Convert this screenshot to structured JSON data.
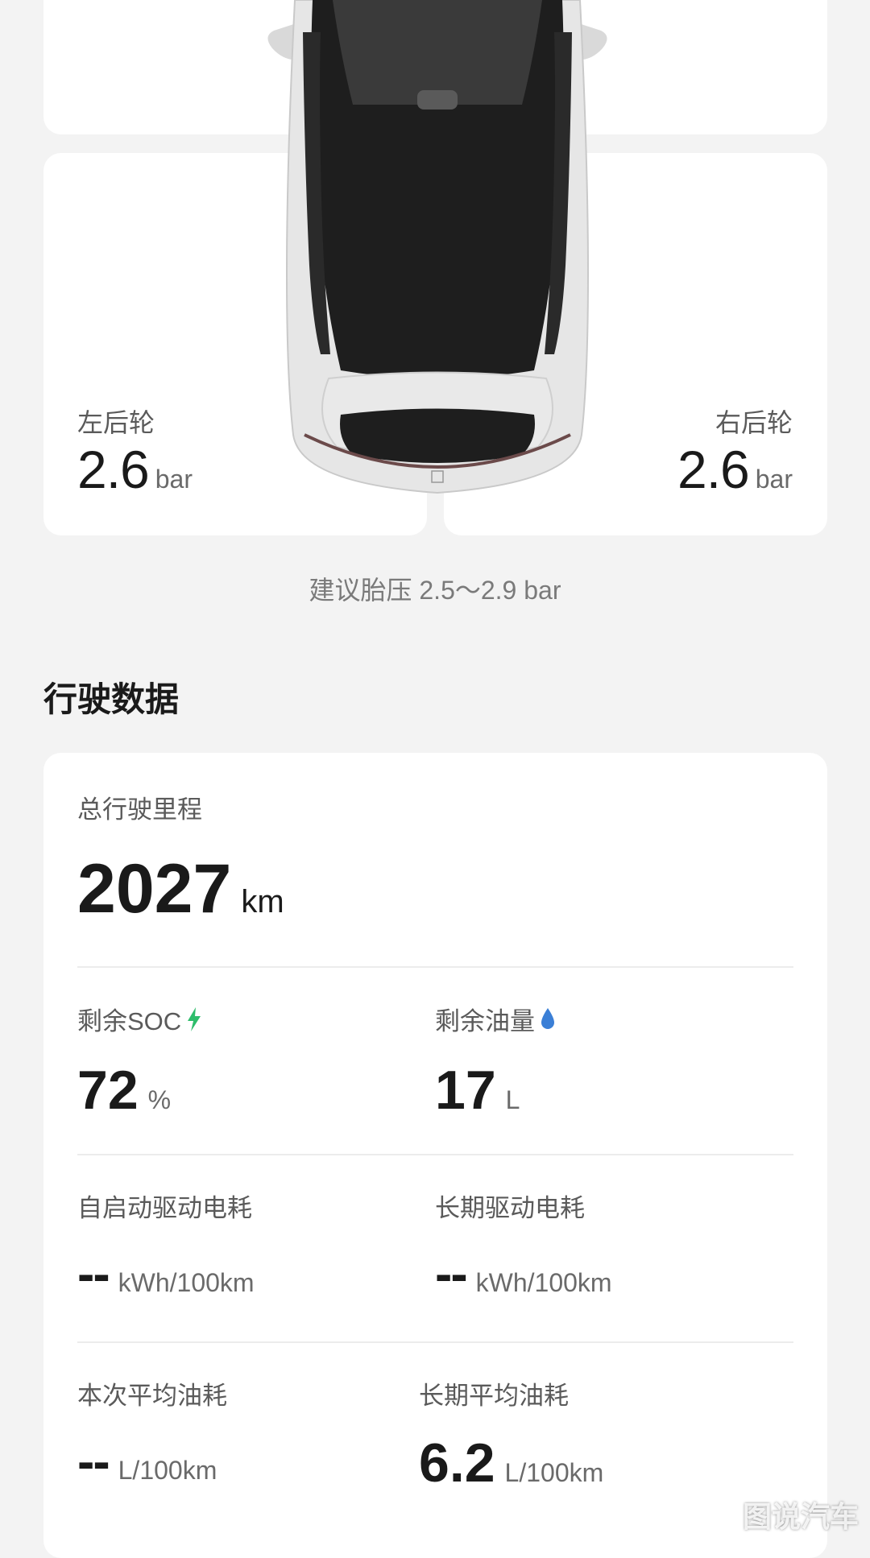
{
  "tires": {
    "rear_left": {
      "label": "左后轮",
      "value": "2.6",
      "unit": "bar"
    },
    "rear_right": {
      "label": "右后轮",
      "value": "2.6",
      "unit": "bar"
    },
    "recommendation": "建议胎压 2.5～2.9 bar"
  },
  "driving": {
    "section_title": "行驶数据",
    "total_mileage": {
      "label": "总行驶里程",
      "value": "2027",
      "unit": "km"
    },
    "soc": {
      "label": "剩余SOC",
      "value": "72",
      "unit": "%",
      "icon": "lightning-icon",
      "icon_color": "#2ebd6b"
    },
    "fuel": {
      "label": "剩余油量",
      "value": "17",
      "unit": "L",
      "icon": "droplet-icon",
      "icon_color": "#3b7fd6"
    },
    "trip_energy": {
      "label": "自启动驱动电耗",
      "value": "--",
      "unit": "kWh/100km"
    },
    "long_energy": {
      "label": "长期驱动电耗",
      "value": "--",
      "unit": "kWh/100km"
    },
    "trip_fuel": {
      "label": "本次平均油耗",
      "value": "--",
      "unit": "L/100km"
    },
    "long_fuel": {
      "label": "长期平均油耗",
      "value": "6.2",
      "unit": "L/100km"
    }
  },
  "watermark": "图说汽车"
}
